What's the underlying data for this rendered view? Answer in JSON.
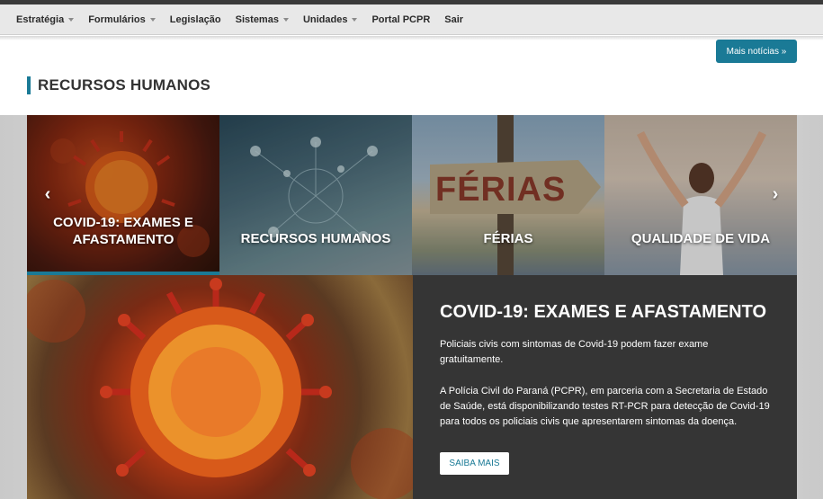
{
  "nav": {
    "items": [
      {
        "label": "Estratégia",
        "dropdown": true
      },
      {
        "label": "Formulários",
        "dropdown": true
      },
      {
        "label": "Legislação",
        "dropdown": false
      },
      {
        "label": "Sistemas",
        "dropdown": true
      },
      {
        "label": "Unidades",
        "dropdown": true
      },
      {
        "label": "Portal PCPR",
        "dropdown": false
      },
      {
        "label": "Sair",
        "dropdown": false
      }
    ]
  },
  "header": {
    "more_news_label": "Mais notícias »",
    "section_title": "RECURSOS HUMANOS"
  },
  "carousel": {
    "prev_icon": "‹",
    "next_icon": "›",
    "tabs": [
      {
        "label": "COVID-19: EXAMES E AFASTAMENTO",
        "active": true
      },
      {
        "label": "RECURSOS HUMANOS",
        "active": false
      },
      {
        "label": "FÉRIAS",
        "active": false
      },
      {
        "label": "QUALIDADE DE VIDA",
        "active": false
      }
    ]
  },
  "feature": {
    "title": "COVID-19: EXAMES E AFASTAMENTO",
    "paragraph1": "Policiais civis com sintomas de Covid-19 podem fazer exame gratuitamente.",
    "paragraph2": "A Polícia Civil do Paraná (PCPR), em parceria com a Secretaria de Estado de Saúde, está disponibilizando testes RT-PCR para detecção de Covid-19 para todos os policiais civis que apresentarem sintomas da doença.",
    "button_label": "SAIBA MAIS",
    "ferias_sign": "FÉRIAS"
  },
  "colors": {
    "accent": "#1a7a96",
    "panel": "#353535"
  }
}
